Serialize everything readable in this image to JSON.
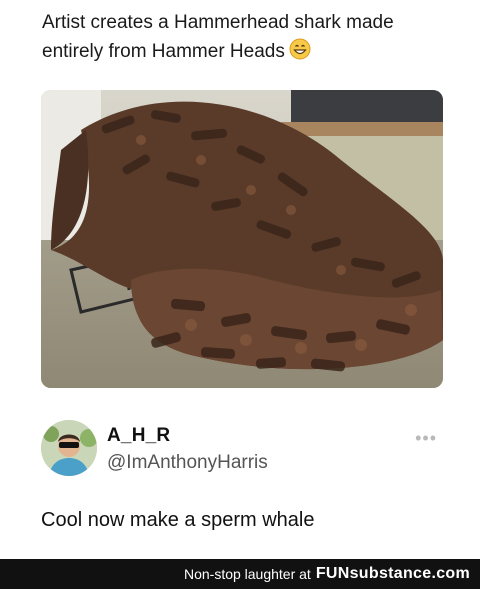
{
  "post": {
    "caption": "Artist creates a Hammerhead shark made entirely from Hammer Heads",
    "caption_emoji_icon": "grinning-face-icon"
  },
  "photo": {
    "subject_icon": "hammer-sculpture-photo"
  },
  "tweet": {
    "display_name": "A_H_R",
    "handle": "@ImAnthonyHarris",
    "more_icon": "more-options-icon",
    "text": "Cool now make a sperm whale"
  },
  "footer": {
    "prefix": "Non-stop laughter at",
    "brand": "FUNsubstance.com",
    "background": "#111111"
  }
}
